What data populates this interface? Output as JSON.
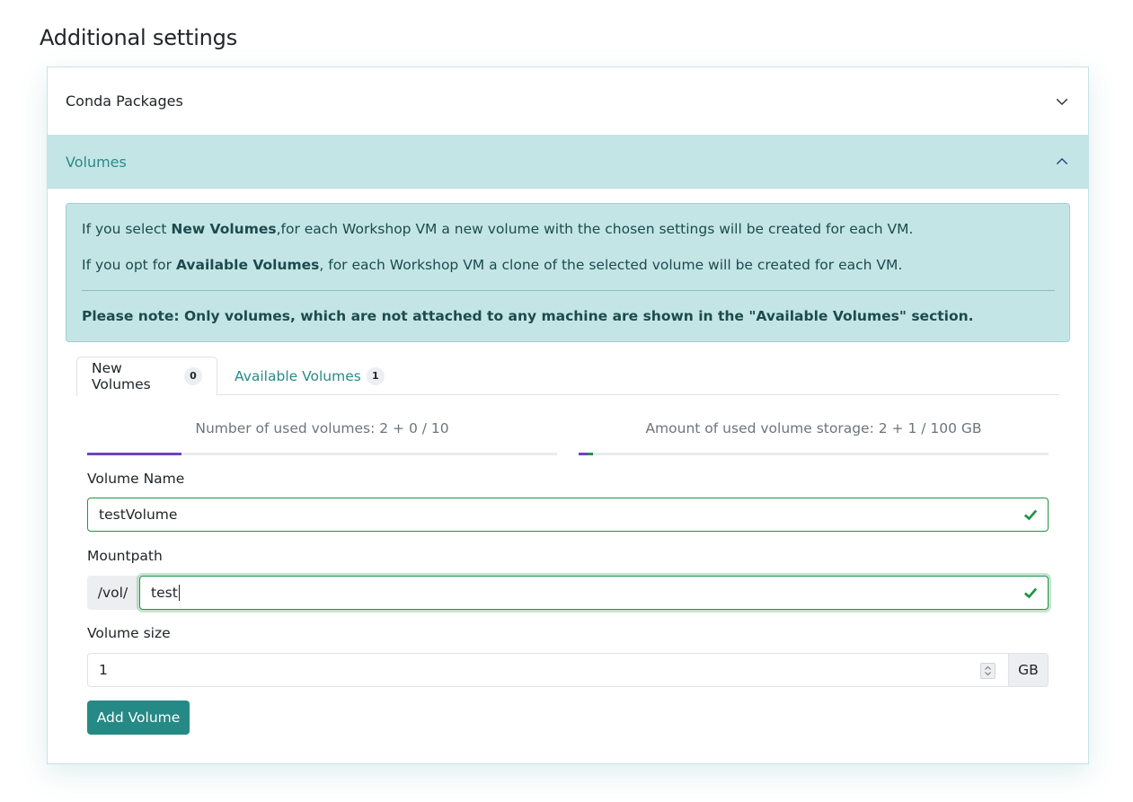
{
  "page": {
    "title": "Additional settings"
  },
  "accordion": {
    "conda": {
      "label": "Conda Packages"
    },
    "volumes": {
      "label": "Volumes"
    }
  },
  "alert": {
    "p1_prefix": "If you select ",
    "p1_bold": "New Volumes",
    "p1_suffix": ",for each Workshop VM a new volume with the chosen settings will be created for each VM.",
    "p2_prefix": "If you opt for ",
    "p2_bold": "Available Volumes",
    "p2_suffix": ", for each Workshop VM a clone of the selected volume will be created for each VM.",
    "note": "Please note: Only volumes, which are not attached to any machine are shown in the \"Available Volumes\" section."
  },
  "tabs": [
    {
      "label": "New Volumes",
      "count": "0"
    },
    {
      "label": "Available Volumes",
      "count": "1"
    }
  ],
  "stats": {
    "volumes_text": "Number of used volumes: 2 + 0 / 10",
    "storage_text": "Amount of used volume storage: 2 + 1 / 100 GB",
    "volumes_progress": {
      "used": 2,
      "new": 0,
      "max": 10
    },
    "storage_progress": {
      "used": 2,
      "new": 1,
      "max": 100
    }
  },
  "form": {
    "name_label": "Volume Name",
    "name_value": "testVolume",
    "mount_label": "Mountpath",
    "mount_prefix": "/vol/",
    "mount_value": "test",
    "size_label": "Volume size",
    "size_value": "1",
    "size_unit": "GB",
    "submit_label": "Add Volume"
  },
  "colors": {
    "accent": "#258a85",
    "valid": "#1f9445",
    "progress_used": "#6f42c1",
    "progress_new": "#1f9445"
  }
}
